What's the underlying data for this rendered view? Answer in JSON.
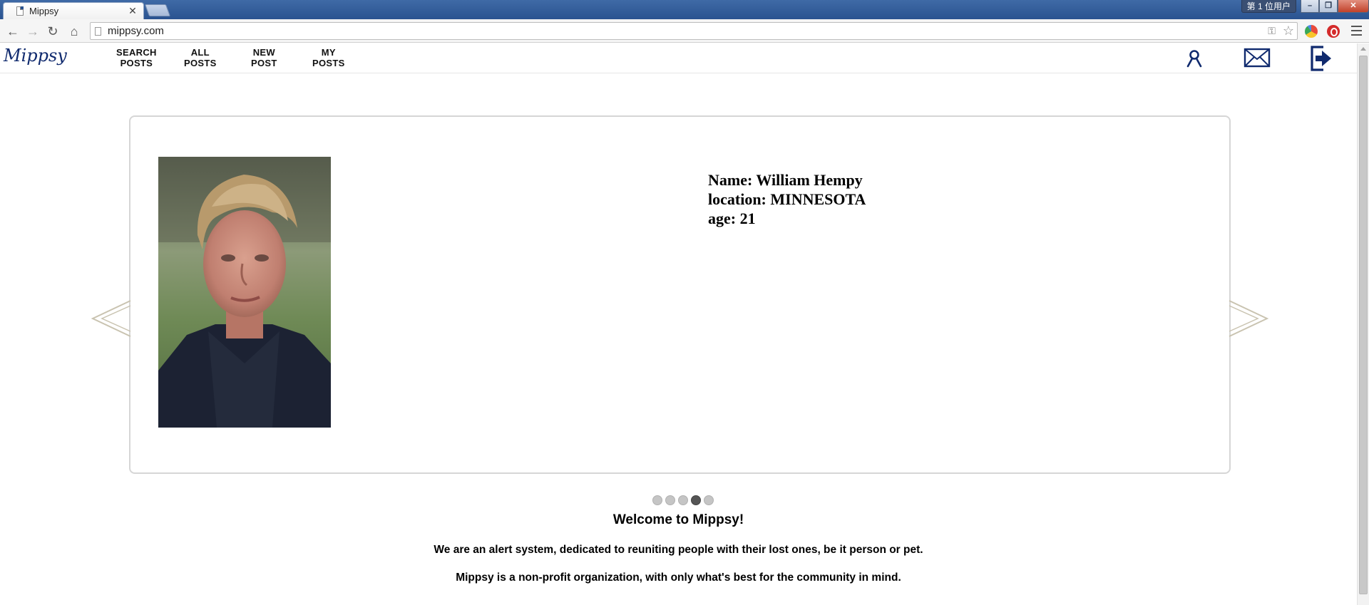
{
  "browser": {
    "tab_title": "Mippsy",
    "tab_close": "✕",
    "user_badge": "第 1 位用户",
    "url": "mippsy.com",
    "window_buttons": {
      "minimize": "–",
      "restore": "❐",
      "close": "✕"
    },
    "nav_icons": {
      "back": "←",
      "forward": "→",
      "reload": "↻",
      "home": "⌂"
    }
  },
  "site": {
    "logo": "Mippsy",
    "nav": [
      {
        "line1": "SEARCH",
        "line2": "POSTS"
      },
      {
        "line1": "ALL",
        "line2": "POSTS"
      },
      {
        "line1": "NEW",
        "line2": "POST"
      },
      {
        "line1": "MY",
        "line2": "POSTS"
      }
    ],
    "header_icons": [
      "profile-icon",
      "mail-icon",
      "logout-icon"
    ]
  },
  "slide": {
    "name_line": "Name: William Hempy",
    "location_line": "location: MINNESOTA",
    "age_line": "age: 21",
    "dot_count": 5,
    "active_dot": 4
  },
  "content": {
    "welcome": "Welcome to Mippsy!",
    "tagline": "We are an alert system, dedicated to reuniting people with their lost ones, be it person or pet.",
    "mission": "Mippsy is a non-profit organization, with only what's best for the community in mind."
  },
  "colors": {
    "brand": "#102a6e",
    "titlebar": "#2a5390"
  }
}
